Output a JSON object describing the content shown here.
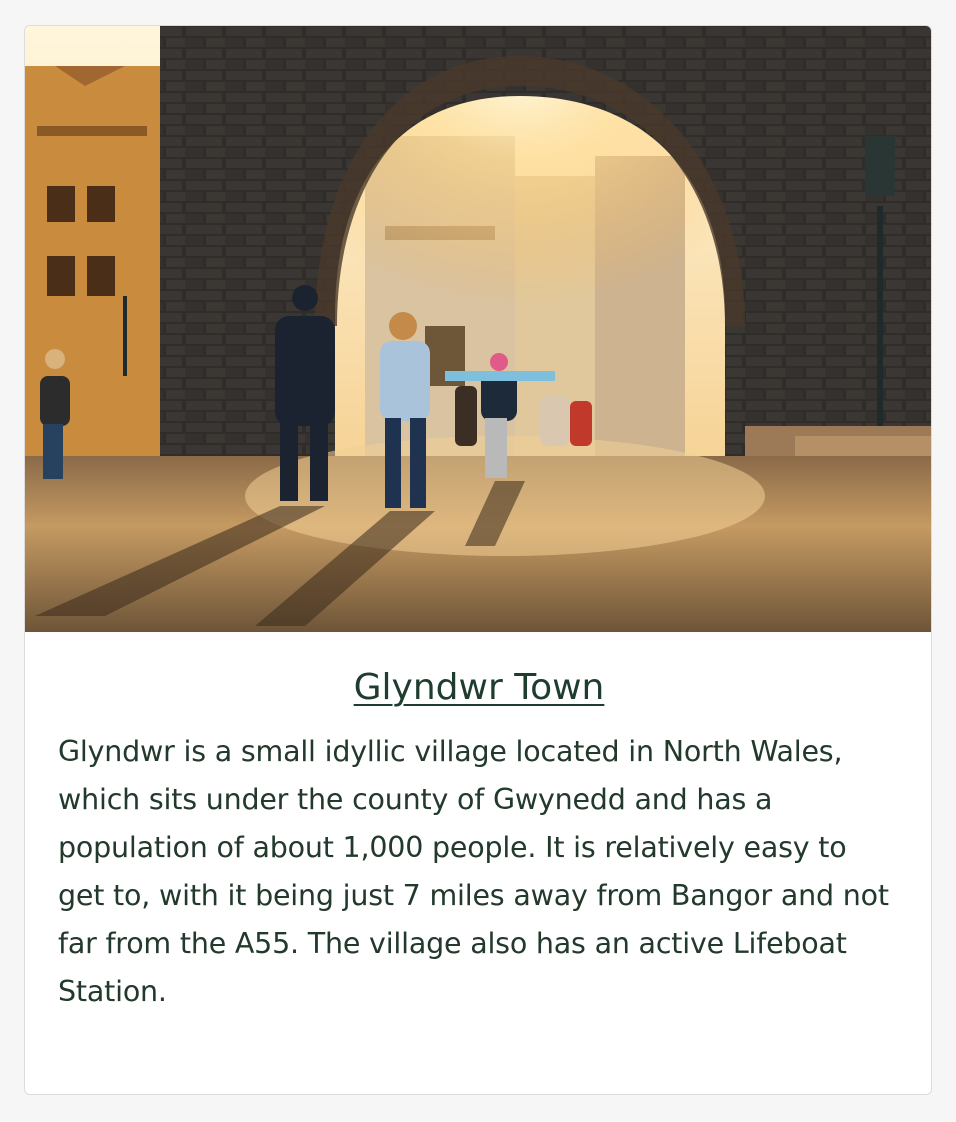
{
  "card": {
    "title": "Glyndwr Town",
    "description": "Glyndwr is a small idyllic village located in North Wales, which sits under the county of Gwynedd and has a population of about 1,000 people. It is relatively easy to get to, with it being just 7 miles away from Bangor and not far from the A55. The village also has an active Lifeboat Station."
  },
  "colors": {
    "text": "#22392c",
    "title": "#1f3d2e",
    "page_bg": "#f6f6f6",
    "card_bg": "#ffffff"
  }
}
